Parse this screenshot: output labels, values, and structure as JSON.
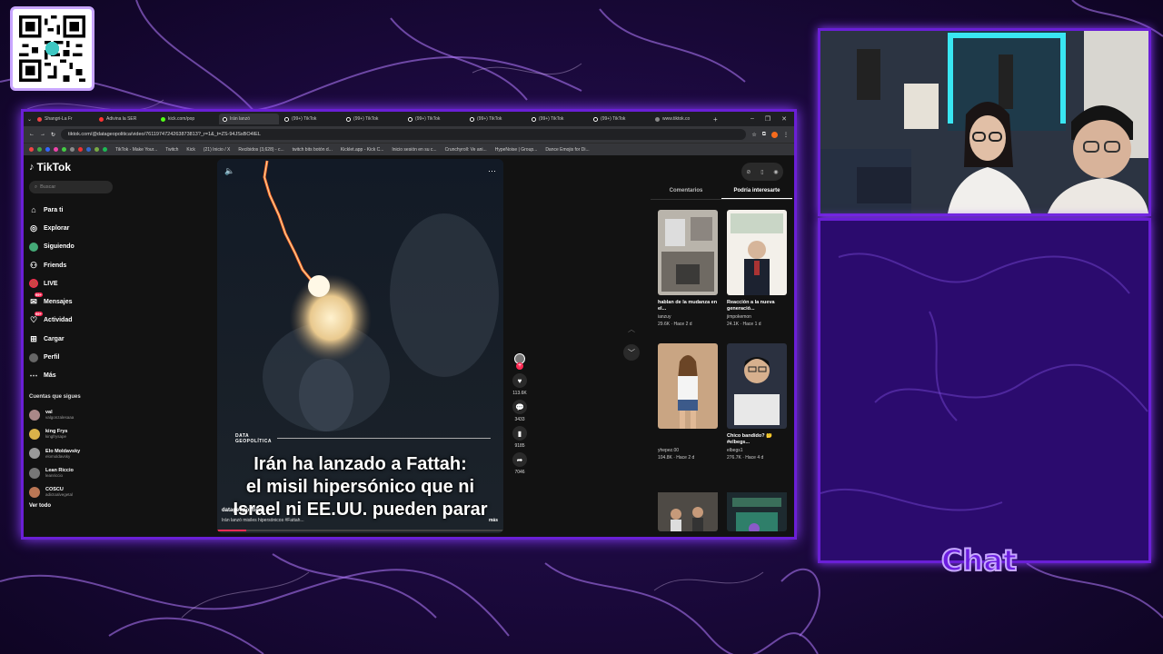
{
  "browser": {
    "tabs": [
      "Shangri-La Fr",
      "Adivina la SER",
      "kick.com/pop",
      "Irán lanzó",
      "(99+) TikTok",
      "(99+) TikTok",
      "(99+) TikTok",
      "(99+) TikTok",
      "(99+) TikTok",
      "(99+) TikTok",
      "www.tiktok.co"
    ],
    "url": "tiktok.com/@datageopolitica/video/7611974724263873813?_r=1&_t=ZS-94JSsBO4IEL",
    "bookmarks": [
      "TikTok - Make Your...",
      "Twitch",
      "Kick",
      "(21) Inicio / X",
      "Recibidos (3,628) - c...",
      "twitch bits botón d...",
      "Kicklet.app - Kick C...",
      "Inicio sesión en su c...",
      "Crunchyroll: Ve ani...",
      "HypeNoise | Group...",
      "Dance Emojis for Di..."
    ]
  },
  "tiktok": {
    "logo": "TikTok",
    "search_placeholder": "Buscar",
    "nav": [
      {
        "label": "Para ti",
        "icon": "home-icon"
      },
      {
        "label": "Explorar",
        "icon": "compass-icon"
      },
      {
        "label": "Siguiendo",
        "icon": "following-icon"
      },
      {
        "label": "Friends",
        "icon": "friends-icon"
      },
      {
        "label": "LIVE",
        "icon": "live-icon"
      },
      {
        "label": "Mensajes",
        "icon": "message-icon",
        "badge": "99+"
      },
      {
        "label": "Actividad",
        "icon": "activity-icon",
        "badge": "99+"
      },
      {
        "label": "Cargar",
        "icon": "upload-icon"
      },
      {
        "label": "Perfil",
        "icon": "profile-icon"
      },
      {
        "label": "Más",
        "icon": "more-icon"
      }
    ],
    "following_header": "Cuentas que sigues",
    "following": [
      {
        "name": "val",
        "handle": "valgonzalesaaa"
      },
      {
        "name": "king Frys",
        "handle": "kingfrysape"
      },
      {
        "name": "Elo Moldavsky",
        "handle": "elomoldavsky"
      },
      {
        "name": "Lean Riccio",
        "handle": "leanriccio"
      },
      {
        "name": "COSCU",
        "handle": "adictoalvegetal"
      }
    ],
    "see_all": "Ver todo",
    "video": {
      "source_label": "DATA GEOPOLÍTICA",
      "caption_lines": [
        "Irán ha lanzado a Fattah:",
        "el misil hipersónico que ni",
        "Israel ni EE.UU. pueden parar"
      ],
      "author": "datageopolitica",
      "description": "Irán lanzó misiles hipersónicos #Fattah...",
      "more": "más",
      "progress": 0.1
    },
    "actions": {
      "likes": "113.6K",
      "comments": "3433",
      "saves": "9185",
      "shares": "7046"
    },
    "right_tabs": [
      "Comentarios",
      "Podría interesarte"
    ],
    "active_right_tab": 1,
    "recommendations": [
      {
        "title": "hablan de la mudanza en el...",
        "user": "ianzuy",
        "meta": "29.6K · Hace 2 d"
      },
      {
        "title": "Reacción a la nueva generació...",
        "user": "jimpokemon",
        "meta": "24.1K · Hace 1 d"
      },
      {
        "title": "",
        "user": "yhepez.00",
        "meta": "104.8K · Hace 2 d"
      },
      {
        "title": "Chico bandido? 🤔 #elbegs...",
        "user": "elbegs1",
        "meta": "276.7K · Hace 4 d"
      }
    ]
  },
  "overlay": {
    "chat_label": "Chat"
  }
}
